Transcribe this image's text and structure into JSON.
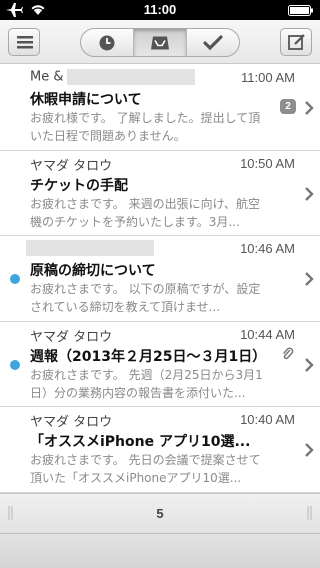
{
  "status_bar": {
    "time": "11:00",
    "icons": [
      "airplane-icon",
      "wifi-icon",
      "battery-icon"
    ]
  },
  "toolbar": {
    "menu_icon": "menu-icon",
    "tabs": [
      {
        "icon": "clock-icon",
        "active": false
      },
      {
        "icon": "inbox-icon",
        "active": true
      },
      {
        "icon": "check-icon",
        "active": false
      }
    ],
    "compose_icon": "compose-icon"
  },
  "messages": [
    {
      "sender": "Me &",
      "time": "11:00 AM",
      "subject": "休暇申請について",
      "preview": "お疲れ様です。 了解しました。提出して頂いた日程で問題ありません。",
      "thread_count": "2",
      "unread": false,
      "attachment": false
    },
    {
      "sender": "ヤマダ タロウ",
      "time": "10:50 AM",
      "subject": "チケットの手配",
      "preview": "お疲れさまです。 来週の出張に向け、航空機のチケットを予約いたします。3月...",
      "thread_count": "",
      "unread": false,
      "attachment": false
    },
    {
      "sender": "",
      "time": "10:46 AM",
      "subject": "原稿の締切について",
      "preview": "お疲れさまです。 以下の原稿ですが、設定されている締切を教えて頂けませ...",
      "thread_count": "",
      "unread": true,
      "attachment": false
    },
    {
      "sender": "ヤマダ タロウ",
      "time": "10:44 AM",
      "subject": "週報（2013年２月25日～３月1日）",
      "preview": "お疲れさまです。 先週（2月25日から3月1日）分の業務内容の報告書を添付いた...",
      "thread_count": "",
      "unread": true,
      "attachment": true
    },
    {
      "sender": "ヤマダ タロウ",
      "time": "10:40 AM",
      "subject": "「オススメiPhone アプリ10選...",
      "preview": "お疲れさまです。 先日の会議で提案させて頂いた「オススメiPhoneアプリ10選...",
      "thread_count": "",
      "unread": false,
      "attachment": false
    }
  ],
  "footer": {
    "count": "5"
  },
  "colors": {
    "unread_dot": "#3ea6dc",
    "badge": "#8d8d8d"
  }
}
